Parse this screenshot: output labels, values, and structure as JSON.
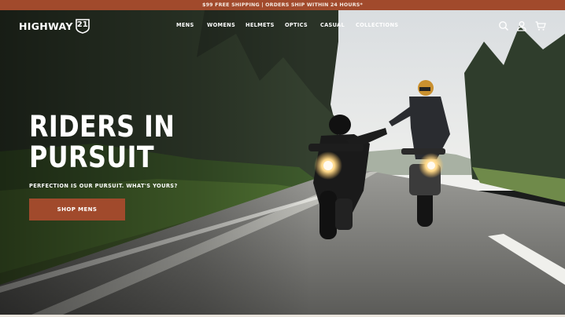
{
  "announcement": {
    "text": "$99 FREE SHIPPING | ORDERS SHIP WITHIN 24 HOURS*"
  },
  "brand": {
    "name": "HIGHWAY",
    "badge": "21"
  },
  "nav": {
    "items": [
      {
        "label": "MENS"
      },
      {
        "label": "WOMENS"
      },
      {
        "label": "HELMETS"
      },
      {
        "label": "OPTICS"
      },
      {
        "label": "CASUAL"
      },
      {
        "label": "COLLECTIONS"
      }
    ]
  },
  "utility": {
    "icons": [
      "search-icon",
      "account-icon",
      "cart-icon"
    ]
  },
  "hero": {
    "headline_line1": "RIDERS IN",
    "headline_line2": "PURSUIT",
    "subline": "PERFECTION IS OUR PURSUIT. WHAT'S YOURS?",
    "cta_label": "SHOP MENS",
    "image_subject": "two-motorcycle-riders-high-five-on-forest-road"
  },
  "colors": {
    "accent": "#a14a2c",
    "text": "#ffffff"
  }
}
